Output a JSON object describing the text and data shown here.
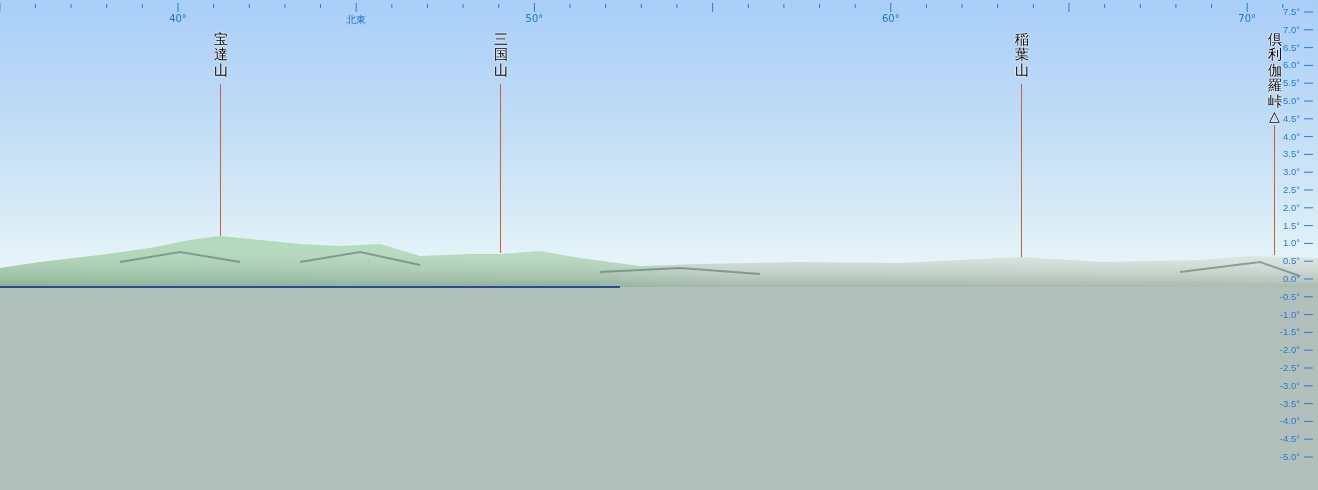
{
  "azimuth_ruler": {
    "labels": [
      {
        "text": "40°"
      },
      {
        "text": "北東"
      },
      {
        "text": "50°"
      },
      {
        "text": "60°"
      },
      {
        "text": "70°"
      }
    ]
  },
  "peaks": [
    {
      "name": "宝達山"
    },
    {
      "name": "三国山"
    },
    {
      "name": "稲葉山"
    },
    {
      "name": "倶利伽羅峠△"
    }
  ],
  "elevation_scale": {
    "labels": [
      "7.5°",
      "7.0°",
      "6.5°",
      "6.0°",
      "5.5°",
      "5.0°",
      "4.5°",
      "4.0°",
      "3.5°",
      "3.0°",
      "2.5°",
      "2.0°",
      "1.5°",
      "1.0°",
      "0.5°",
      "0.0°",
      "-0.5°",
      "-1.0°",
      "-1.5°",
      "-2.0°",
      "-2.5°",
      "-3.0°",
      "-3.5°",
      "-4.0°",
      "-4.5°",
      "-5.0°"
    ]
  }
}
